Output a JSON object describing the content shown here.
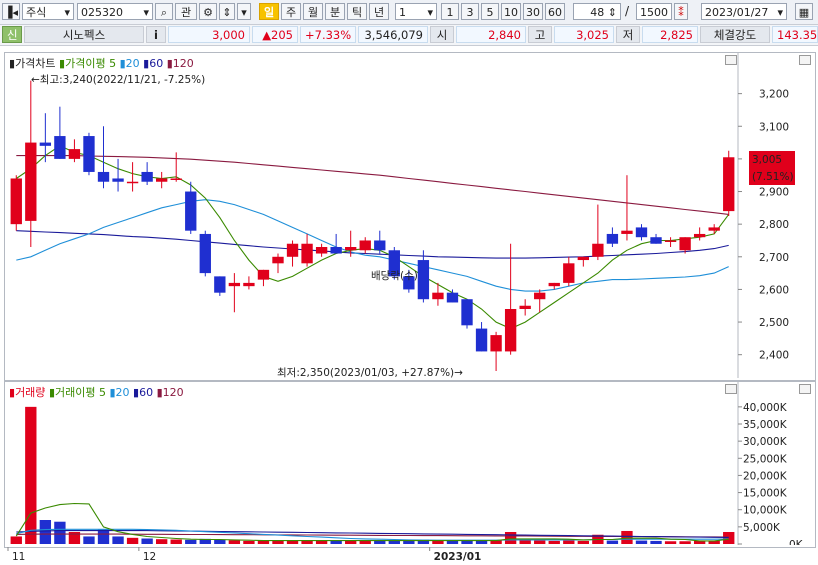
{
  "toolbar": {
    "market_type": "주식",
    "stock_code": "025320",
    "search_icon": "search-icon",
    "btn_gwan": "관",
    "period_buttons": [
      "일",
      "주",
      "월",
      "분",
      "틱",
      "년"
    ],
    "interval_select": "1",
    "interval_buttons": [
      "1",
      "3",
      "5",
      "10",
      "30",
      "60"
    ],
    "view_count": "48",
    "total_count": "1500",
    "separator": "/",
    "date": "2023/01/27"
  },
  "quote": {
    "tag": "신",
    "name": "시노펙스",
    "info": "i",
    "price": "3,000",
    "change": "▲205",
    "change_pct": "+7.33%",
    "volume": "3,546,079",
    "open_label": "시",
    "open": "2,840",
    "high_label": "고",
    "high": "3,025",
    "low_label": "저",
    "low": "2,825",
    "strength_label": "체결강도",
    "strength": "143.35"
  },
  "price_panel": {
    "legend": [
      {
        "text": "가격차트",
        "color": "#000000"
      },
      {
        "text": "가격이평 5",
        "color": "#3a8a00"
      },
      {
        "text": "20",
        "color": "#1f8fd8"
      },
      {
        "text": "60",
        "color": "#1a1a9a"
      },
      {
        "text": "120",
        "color": "#8a1a40"
      }
    ],
    "max_annotation": "←최고:3,240(2022/11/21, -7.25%)",
    "min_annotation": "최저:2,350(2023/01/03, +27.87%)→",
    "dividend_label": "배당락(수)",
    "last_price": "3,005",
    "last_change": "(7.51%)",
    "y_ticks": [
      "3,200",
      "3,100",
      "3,000",
      "2,900",
      "2,800",
      "2,700",
      "2,600",
      "2,500",
      "2,400"
    ]
  },
  "volume_panel": {
    "legend": [
      {
        "text": "거래량",
        "color": "#e0001b"
      },
      {
        "text": "거래이평 5",
        "color": "#3a8a00"
      },
      {
        "text": "20",
        "color": "#1f8fd8"
      },
      {
        "text": "60",
        "color": "#1a1a9a"
      },
      {
        "text": "120",
        "color": "#8a1a40"
      }
    ],
    "y_ticks": [
      "40,000K",
      "35,000K",
      "30,000K",
      "25,000K",
      "20,000K",
      "15,000K",
      "10,000K",
      "5,000K",
      "0K"
    ]
  },
  "x_axis": {
    "labels": [
      "11",
      "12",
      "2023/01"
    ]
  },
  "colors": {
    "up": "#e0001b",
    "down": "#1f2fd0",
    "ma5": "#3a8a00",
    "ma20": "#1f8fd8",
    "ma60": "#1a1a9a",
    "ma120": "#8a1a40"
  },
  "chart_data": {
    "type": "candlestick",
    "title": "가격차트",
    "ylim": [
      2350,
      3300
    ],
    "volume_ylim": [
      0,
      42000
    ],
    "x_labels": [
      "11",
      "12",
      "2023/01"
    ],
    "candles": [
      {
        "o": 2800,
        "h": 2950,
        "l": 2780,
        "c": 2940
      },
      {
        "o": 2810,
        "h": 3240,
        "l": 2730,
        "c": 3050
      },
      {
        "o": 3050,
        "h": 3140,
        "l": 2990,
        "c": 3040
      },
      {
        "o": 3070,
        "h": 3160,
        "l": 3000,
        "c": 3000
      },
      {
        "o": 3000,
        "h": 3060,
        "l": 2990,
        "c": 3030
      },
      {
        "o": 3070,
        "h": 3080,
        "l": 2950,
        "c": 2960
      },
      {
        "o": 2960,
        "h": 3100,
        "l": 2910,
        "c": 2930
      },
      {
        "o": 2940,
        "h": 3000,
        "l": 2900,
        "c": 2930
      },
      {
        "o": 2930,
        "h": 2990,
        "l": 2900,
        "c": 2930
      },
      {
        "o": 2960,
        "h": 2990,
        "l": 2920,
        "c": 2930
      },
      {
        "o": 2930,
        "h": 2960,
        "l": 2910,
        "c": 2940
      },
      {
        "o": 2940,
        "h": 3020,
        "l": 2930,
        "c": 2940
      },
      {
        "o": 2900,
        "h": 2930,
        "l": 2770,
        "c": 2780
      },
      {
        "o": 2770,
        "h": 2780,
        "l": 2640,
        "c": 2650
      },
      {
        "o": 2640,
        "h": 2640,
        "l": 2580,
        "c": 2590
      },
      {
        "o": 2610,
        "h": 2650,
        "l": 2530,
        "c": 2620
      },
      {
        "o": 2610,
        "h": 2640,
        "l": 2600,
        "c": 2620
      },
      {
        "o": 2630,
        "h": 2660,
        "l": 2610,
        "c": 2660
      },
      {
        "o": 2680,
        "h": 2710,
        "l": 2650,
        "c": 2700
      },
      {
        "o": 2700,
        "h": 2750,
        "l": 2670,
        "c": 2740
      },
      {
        "o": 2680,
        "h": 2770,
        "l": 2670,
        "c": 2740
      },
      {
        "o": 2710,
        "h": 2740,
        "l": 2700,
        "c": 2730
      },
      {
        "o": 2730,
        "h": 2770,
        "l": 2710,
        "c": 2710
      },
      {
        "o": 2720,
        "h": 2780,
        "l": 2700,
        "c": 2730
      },
      {
        "o": 2720,
        "h": 2760,
        "l": 2710,
        "c": 2750
      },
      {
        "o": 2750,
        "h": 2780,
        "l": 2710,
        "c": 2720
      },
      {
        "o": 2720,
        "h": 2730,
        "l": 2630,
        "c": 2640
      },
      {
        "o": 2640,
        "h": 2660,
        "l": 2590,
        "c": 2600
      },
      {
        "o": 2690,
        "h": 2720,
        "l": 2560,
        "c": 2570
      },
      {
        "o": 2570,
        "h": 2620,
        "l": 2550,
        "c": 2590
      },
      {
        "o": 2590,
        "h": 2600,
        "l": 2560,
        "c": 2560
      },
      {
        "o": 2570,
        "h": 2570,
        "l": 2480,
        "c": 2490
      },
      {
        "o": 2480,
        "h": 2500,
        "l": 2410,
        "c": 2410
      },
      {
        "o": 2410,
        "h": 2470,
        "l": 2350,
        "c": 2460
      },
      {
        "o": 2410,
        "h": 2740,
        "l": 2400,
        "c": 2540
      },
      {
        "o": 2540,
        "h": 2570,
        "l": 2520,
        "c": 2550
      },
      {
        "o": 2570,
        "h": 2600,
        "l": 2530,
        "c": 2590
      },
      {
        "o": 2610,
        "h": 2620,
        "l": 2600,
        "c": 2620
      },
      {
        "o": 2620,
        "h": 2700,
        "l": 2610,
        "c": 2680
      },
      {
        "o": 2690,
        "h": 2700,
        "l": 2670,
        "c": 2700
      },
      {
        "o": 2700,
        "h": 2860,
        "l": 2690,
        "c": 2740
      },
      {
        "o": 2770,
        "h": 2790,
        "l": 2730,
        "c": 2740
      },
      {
        "o": 2770,
        "h": 2950,
        "l": 2750,
        "c": 2780
      },
      {
        "o": 2790,
        "h": 2800,
        "l": 2750,
        "c": 2760
      },
      {
        "o": 2760,
        "h": 2770,
        "l": 2740,
        "c": 2740
      },
      {
        "o": 2750,
        "h": 2760,
        "l": 2730,
        "c": 2750
      },
      {
        "o": 2720,
        "h": 2760,
        "l": 2710,
        "c": 2760
      },
      {
        "o": 2760,
        "h": 2790,
        "l": 2750,
        "c": 2770
      },
      {
        "o": 2780,
        "h": 2800,
        "l": 2770,
        "c": 2790
      },
      {
        "o": 2840,
        "h": 3025,
        "l": 2825,
        "c": 3005
      }
    ],
    "ma5": [
      2940,
      2970,
      3010,
      3040,
      3020,
      3010,
      2990,
      2970,
      2955,
      2945,
      2940,
      2945,
      2920,
      2880,
      2820,
      2750,
      2690,
      2640,
      2625,
      2640,
      2665,
      2690,
      2710,
      2720,
      2725,
      2720,
      2700,
      2670,
      2640,
      2615,
      2590,
      2570,
      2540,
      2500,
      2480,
      2500,
      2530,
      2560,
      2590,
      2620,
      2650,
      2690,
      2720,
      2740,
      2750,
      2750,
      2755,
      2760,
      2770,
      2830
    ],
    "ma20": [
      2690,
      2700,
      2720,
      2740,
      2755,
      2770,
      2790,
      2805,
      2820,
      2835,
      2850,
      2860,
      2870,
      2875,
      2870,
      2860,
      2845,
      2830,
      2810,
      2790,
      2770,
      2750,
      2730,
      2715,
      2705,
      2700,
      2690,
      2680,
      2670,
      2660,
      2650,
      2640,
      2625,
      2610,
      2600,
      2595,
      2595,
      2600,
      2610,
      2620,
      2625,
      2630,
      2630,
      2632,
      2634,
      2636,
      2638,
      2642,
      2650,
      2670
    ],
    "ma60": [
      2780,
      2778,
      2776,
      2774,
      2772,
      2770,
      2768,
      2765,
      2762,
      2760,
      2757,
      2754,
      2750,
      2746,
      2742,
      2738,
      2734,
      2730,
      2727,
      2724,
      2721,
      2718,
      2715,
      2712,
      2710,
      2708,
      2706,
      2704,
      2702,
      2700,
      2699,
      2698,
      2697,
      2696,
      2696,
      2696,
      2697,
      2698,
      2699,
      2700,
      2702,
      2704,
      2706,
      2708,
      2710,
      2713,
      2716,
      2720,
      2725,
      2735
    ],
    "ma120": [
      3010,
      3010,
      3010,
      3010,
      3010,
      3009,
      3008,
      3007,
      3006,
      3005,
      3003,
      3001,
      2999,
      2996,
      2993,
      2990,
      2986,
      2982,
      2978,
      2974,
      2970,
      2966,
      2962,
      2958,
      2954,
      2950,
      2945,
      2940,
      2935,
      2930,
      2925,
      2920,
      2915,
      2910,
      2905,
      2900,
      2895,
      2890,
      2885,
      2880,
      2875,
      2870,
      2865,
      2860,
      2855,
      2850,
      2845,
      2840,
      2835,
      2830
    ],
    "volumes": [
      2200,
      40000,
      7000,
      6500,
      3500,
      2200,
      4200,
      2200,
      1800,
      1600,
      1400,
      1300,
      1200,
      1500,
      1200,
      1100,
      900,
      900,
      1000,
      1100,
      900,
      1000,
      1100,
      1000,
      900,
      1000,
      900,
      900,
      1300,
      1100,
      900,
      1000,
      900,
      1200,
      3500,
      1100,
      1000,
      900,
      1000,
      900,
      2700,
      1000,
      3800,
      1000,
      900,
      800,
      800,
      900,
      1000,
      3500
    ],
    "vma5": [
      2300,
      9000,
      10500,
      11500,
      11800,
      11700,
      5000,
      3600,
      2800,
      2200,
      1900,
      1600,
      1400,
      1300,
      1300,
      1200,
      1100,
      1000,
      1000,
      1000,
      1000,
      1000,
      1000,
      1000,
      1000,
      1000,
      1000,
      1000,
      1000,
      1000,
      1000,
      1000,
      1000,
      1000,
      1500,
      1500,
      1500,
      1500,
      1400,
      1200,
      1300,
      1300,
      1700,
      1700,
      1700,
      1400,
      1300,
      900,
      900,
      1400
    ],
    "vma20": [
      3000,
      4000,
      4200,
      4300,
      4300,
      4300,
      4300,
      4300,
      4300,
      4200,
      4100,
      4000,
      3800,
      3600,
      3400,
      3200,
      3000,
      2800,
      2600,
      2400,
      2200,
      2000,
      1800,
      1600,
      1500,
      1400,
      1300,
      1200,
      1150,
      1100,
      1100,
      1100,
      1100,
      1100,
      1200,
      1200,
      1200,
      1200,
      1200,
      1200,
      1300,
      1300,
      1400,
      1400,
      1400,
      1400,
      1400,
      1400,
      1400,
      1500
    ],
    "vma60": [
      3500,
      3700,
      3800,
      3900,
      3900,
      3900,
      3900,
      3900,
      3900,
      3900,
      3850,
      3800,
      3750,
      3700,
      3650,
      3600,
      3550,
      3500,
      3450,
      3400,
      3350,
      3300,
      3250,
      3200,
      3150,
      3100,
      3050,
      3000,
      2950,
      2900,
      2850,
      2800,
      2750,
      2700,
      2650,
      2600,
      2550,
      2500,
      2450,
      2400,
      2350,
      2300,
      2250,
      2200,
      2150,
      2100,
      2050,
      2000,
      1950,
      1900
    ],
    "vma120": [
      2800,
      2850,
      2900,
      2900,
      2900,
      2900,
      2900,
      2880,
      2860,
      2840,
      2820,
      2800,
      2780,
      2760,
      2740,
      2720,
      2700,
      2680,
      2660,
      2640,
      2620,
      2600,
      2580,
      2560,
      2540,
      2520,
      2500,
      2480,
      2460,
      2440,
      2420,
      2400,
      2380,
      2360,
      2340,
      2320,
      2300,
      2280,
      2260,
      2240,
      2220,
      2200,
      2180,
      2160,
      2140,
      2120,
      2100,
      2080,
      2060,
      2040
    ]
  }
}
